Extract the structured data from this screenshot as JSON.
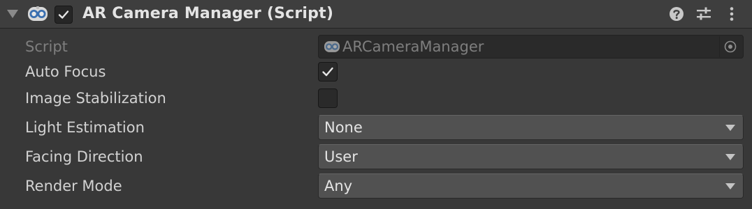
{
  "header": {
    "title": "AR Camera Manager (Script)",
    "foldout_icon": "foldout-expanded-icon",
    "component_icon": "script-icon",
    "enabled_toggle_checked": true,
    "help_icon": "help-icon",
    "presets_icon": "presets-icon",
    "menu_icon": "kebab-menu-icon"
  },
  "properties": {
    "script": {
      "label": "Script",
      "value": "ARCameraManager"
    },
    "auto_focus": {
      "label": "Auto Focus",
      "checked": true
    },
    "image_stabilization": {
      "label": "Image Stabilization",
      "checked": false
    },
    "light_estimation": {
      "label": "Light Estimation",
      "value": "None"
    },
    "facing_direction": {
      "label": "Facing Direction",
      "value": "User"
    },
    "render_mode": {
      "label": "Render Mode",
      "value": "Any"
    }
  },
  "colors": {
    "background": "#383838",
    "header_background": "#3e3e3e",
    "dropdown_background": "#515151",
    "field_background": "#2a2a2a",
    "text": "#d2d2d2",
    "disabled_text": "#7e7e7e"
  }
}
